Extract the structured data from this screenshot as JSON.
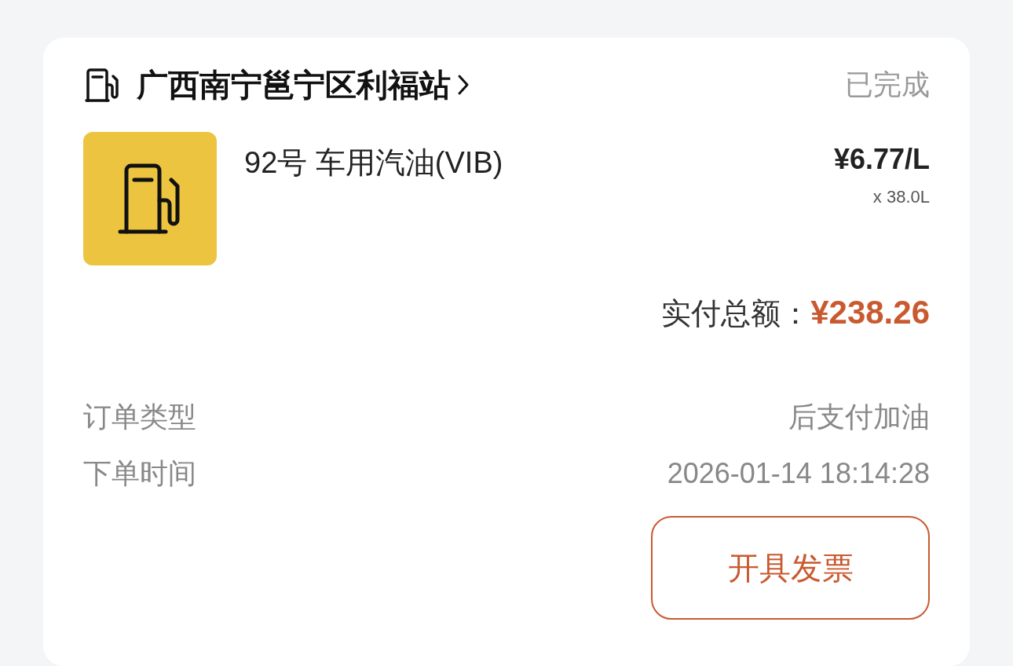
{
  "station": {
    "name": "广西南宁邕宁区利福站",
    "status": "已完成"
  },
  "product": {
    "name": "92号 车用汽油(VIB)",
    "unit_price": "¥6.77/L",
    "quantity": "x 38.0L"
  },
  "total": {
    "label": "实付总额：",
    "amount": "¥238.26"
  },
  "details": [
    {
      "label": "订单类型",
      "value": "后支付加油"
    },
    {
      "label": "下单时间",
      "value": "2026-01-14 18:14:28"
    }
  ],
  "buttons": [
    "开具发票"
  ]
}
